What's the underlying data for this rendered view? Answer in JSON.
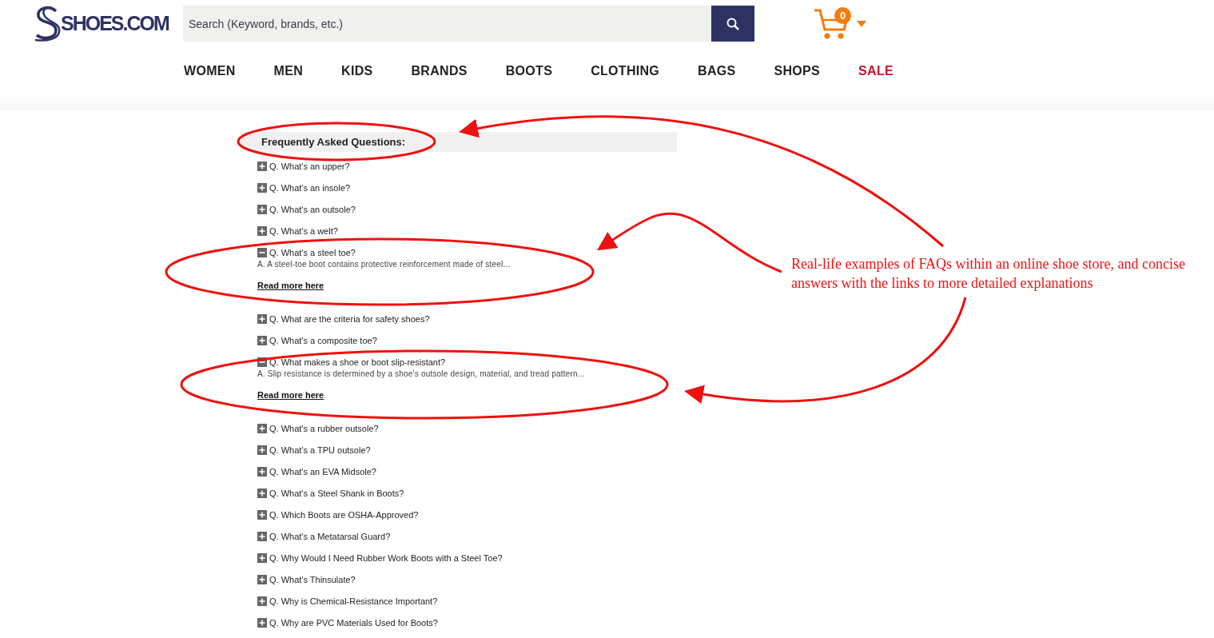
{
  "header": {
    "logo_text": "SHOES.COM",
    "search": {
      "placeholder": "Search (Keyword, brands, etc.)"
    },
    "cart": {
      "count": "0"
    }
  },
  "nav": [
    {
      "label": "WOMEN",
      "kind": "normal"
    },
    {
      "label": "MEN",
      "kind": "normal"
    },
    {
      "label": "KIDS",
      "kind": "normal"
    },
    {
      "label": "BRANDS",
      "kind": "normal"
    },
    {
      "label": "BOOTS",
      "kind": "normal"
    },
    {
      "label": "CLOTHING",
      "kind": "normal"
    },
    {
      "label": "BAGS",
      "kind": "normal"
    },
    {
      "label": "SHOPS",
      "kind": "normal"
    },
    {
      "label": "SALE",
      "kind": "sale"
    }
  ],
  "faq": {
    "title": "Frequently Asked Questions:",
    "items": [
      {
        "question": "Q. What's an upper?",
        "expanded": false
      },
      {
        "question": "Q. What's an insole?",
        "expanded": false
      },
      {
        "question": "Q. What's an outsole?",
        "expanded": false
      },
      {
        "question": "Q. What's a welt?",
        "expanded": false
      },
      {
        "question": "Q. What's a steel toe?",
        "expanded": true,
        "answer": "A. A steel-toe boot contains protective reinforcement made of steel...",
        "link": "Read more here"
      },
      {
        "question": "Q. What are the criteria for safety shoes?",
        "expanded": false
      },
      {
        "question": "Q. What's a composite toe?",
        "expanded": false
      },
      {
        "question": "Q. What makes a shoe or boot slip-resistant?",
        "expanded": true,
        "answer": "A. Slip resistance is determined by a shoe's outsole design, material, and tread pattern...",
        "link": "Read more here"
      },
      {
        "question": "Q. What's a rubber outsole?",
        "expanded": false
      },
      {
        "question": "Q. What's a TPU outsole?",
        "expanded": false
      },
      {
        "question": "Q. What's an EVA Midsole?",
        "expanded": false
      },
      {
        "question": "Q. What's a Steel Shank in Boots?",
        "expanded": false
      },
      {
        "question": "Q. Which Boots are OSHA-Approved?",
        "expanded": false
      },
      {
        "question": "Q. What's a Metatarsal Guard?",
        "expanded": false
      },
      {
        "question": "Q. Why Would I Need Rubber Work Boots with a Steel Toe?",
        "expanded": false
      },
      {
        "question": "Q. What's Thinsulate?",
        "expanded": false
      },
      {
        "question": "Q. Why is Chemical-Resistance Important?",
        "expanded": false
      },
      {
        "question": "Q. Why are PVC Materials Used for Boots?",
        "expanded": false
      }
    ]
  },
  "annotation": {
    "note": "Real-life examples of FAQs within an online shoe store, and concise answers with the links to more detailed explanations"
  }
}
